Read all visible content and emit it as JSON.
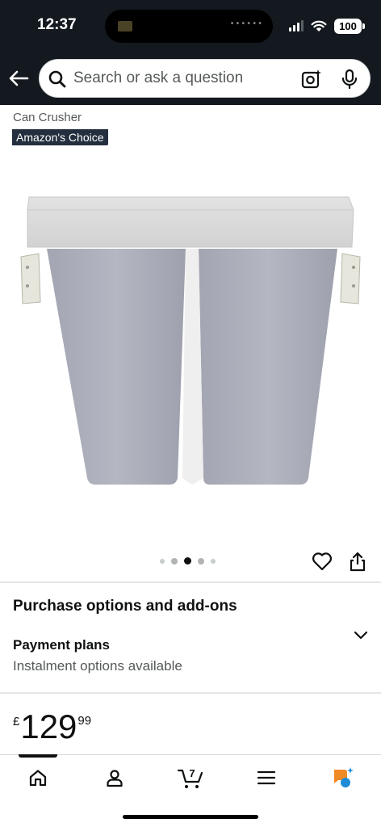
{
  "status_bar": {
    "time": "12:37",
    "battery": "100"
  },
  "search": {
    "placeholder": "Search or ask a question",
    "icons": [
      "back-arrow-icon",
      "search-icon",
      "camera-lens-icon",
      "microphone-icon"
    ]
  },
  "product": {
    "title_fragment": "Can Crusher",
    "badge": "Amazon's Choice",
    "image_description_icon": "double-bin-product-image",
    "carousel": {
      "count": 5,
      "active_index": 2
    }
  },
  "purchase": {
    "heading": "Purchase options and add-ons",
    "payment_plans_label": "Payment plans",
    "payment_plans_sub": "Instalment options available"
  },
  "price": {
    "symbol": "£",
    "whole": "129",
    "fraction": "99"
  },
  "bottom_nav": {
    "items": [
      "home-icon",
      "account-icon",
      "cart-icon",
      "menu-icon",
      "rufus-assistant-icon"
    ],
    "cart_count": "7",
    "active_index": 0
  },
  "colors": {
    "header_bg": "#14191f",
    "badge_bg": "#232f3e",
    "accent_orange": "#f08a24",
    "accent_blue": "#1f8bd6"
  }
}
